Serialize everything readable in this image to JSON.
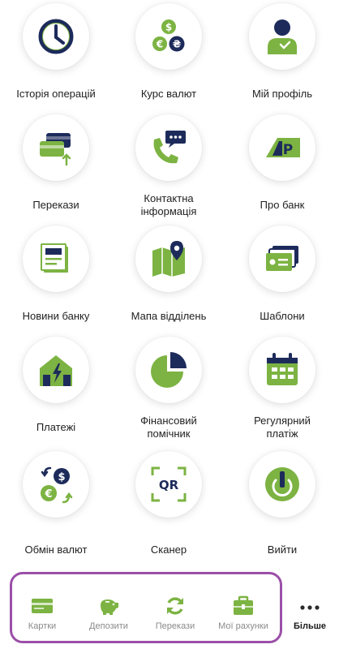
{
  "colors": {
    "accent_green": "#7cb342",
    "dark_navy": "#1d2b5b",
    "tab_icon_green": "#7cb342",
    "highlight_purple": "#9b4fa8"
  },
  "menu": {
    "items": [
      {
        "label": "Історія операцій",
        "icon": "clock-icon"
      },
      {
        "label": "Курс валют",
        "icon": "currency-coins-icon"
      },
      {
        "label": "Мій профіль",
        "icon": "user-profile-icon"
      },
      {
        "label": "Перекази",
        "icon": "card-transfer-icon"
      },
      {
        "label": "Контактна\nінформація",
        "icon": "phone-chat-icon"
      },
      {
        "label": "Про банк",
        "icon": "bank-logo-icon"
      },
      {
        "label": "Новини банку",
        "icon": "news-document-icon"
      },
      {
        "label": "Мапа відділень",
        "icon": "map-pin-icon"
      },
      {
        "label": "Шаблони",
        "icon": "template-cards-icon"
      },
      {
        "label": "Платежі",
        "icon": "house-utility-icon"
      },
      {
        "label": "Фінансовий\nпомічник",
        "icon": "pie-chart-icon"
      },
      {
        "label": "Регулярний\nплатіж",
        "icon": "calendar-icon"
      },
      {
        "label": "Обмін валют",
        "icon": "currency-exchange-icon"
      },
      {
        "label": "Сканер",
        "icon": "qr-scanner-icon"
      },
      {
        "label": "Вийти",
        "icon": "power-icon"
      }
    ]
  },
  "tabbar": {
    "cards": "Картки",
    "deposits": "Депозити",
    "transfers": "Перекази",
    "accounts": "Мої рахунки",
    "more": "Більше"
  }
}
